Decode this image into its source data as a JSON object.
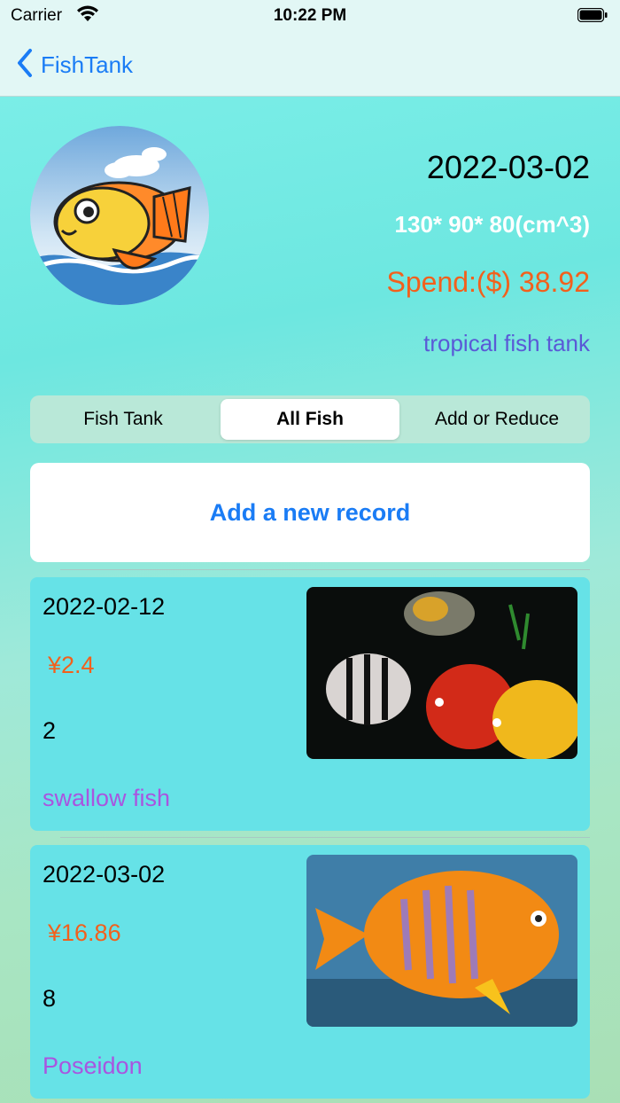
{
  "status_bar": {
    "carrier": "Carrier",
    "time": "10:22 PM"
  },
  "nav": {
    "back_label": "FishTank"
  },
  "tank": {
    "date": "2022-03-02",
    "size": "130* 90* 80(cm^3)",
    "spend": "Spend:($) 38.92",
    "type": "tropical fish tank"
  },
  "segments": [
    {
      "label": "Fish Tank"
    },
    {
      "label": "All Fish"
    },
    {
      "label": "Add or Reduce"
    }
  ],
  "selected_segment": "All Fish",
  "add_record_label": "Add a new record",
  "records": [
    {
      "date": "2022-02-12",
      "price": "¥2.4",
      "count": "2",
      "name": "swallow fish"
    },
    {
      "date": "2022-03-02",
      "price": "¥16.86",
      "count": "8",
      "name": "Poseidon"
    }
  ],
  "colors": {
    "accent": "#1a7cf5",
    "price": "#f2601c",
    "fish_name": "#a955e0",
    "card_bg": "#66e2e7"
  }
}
